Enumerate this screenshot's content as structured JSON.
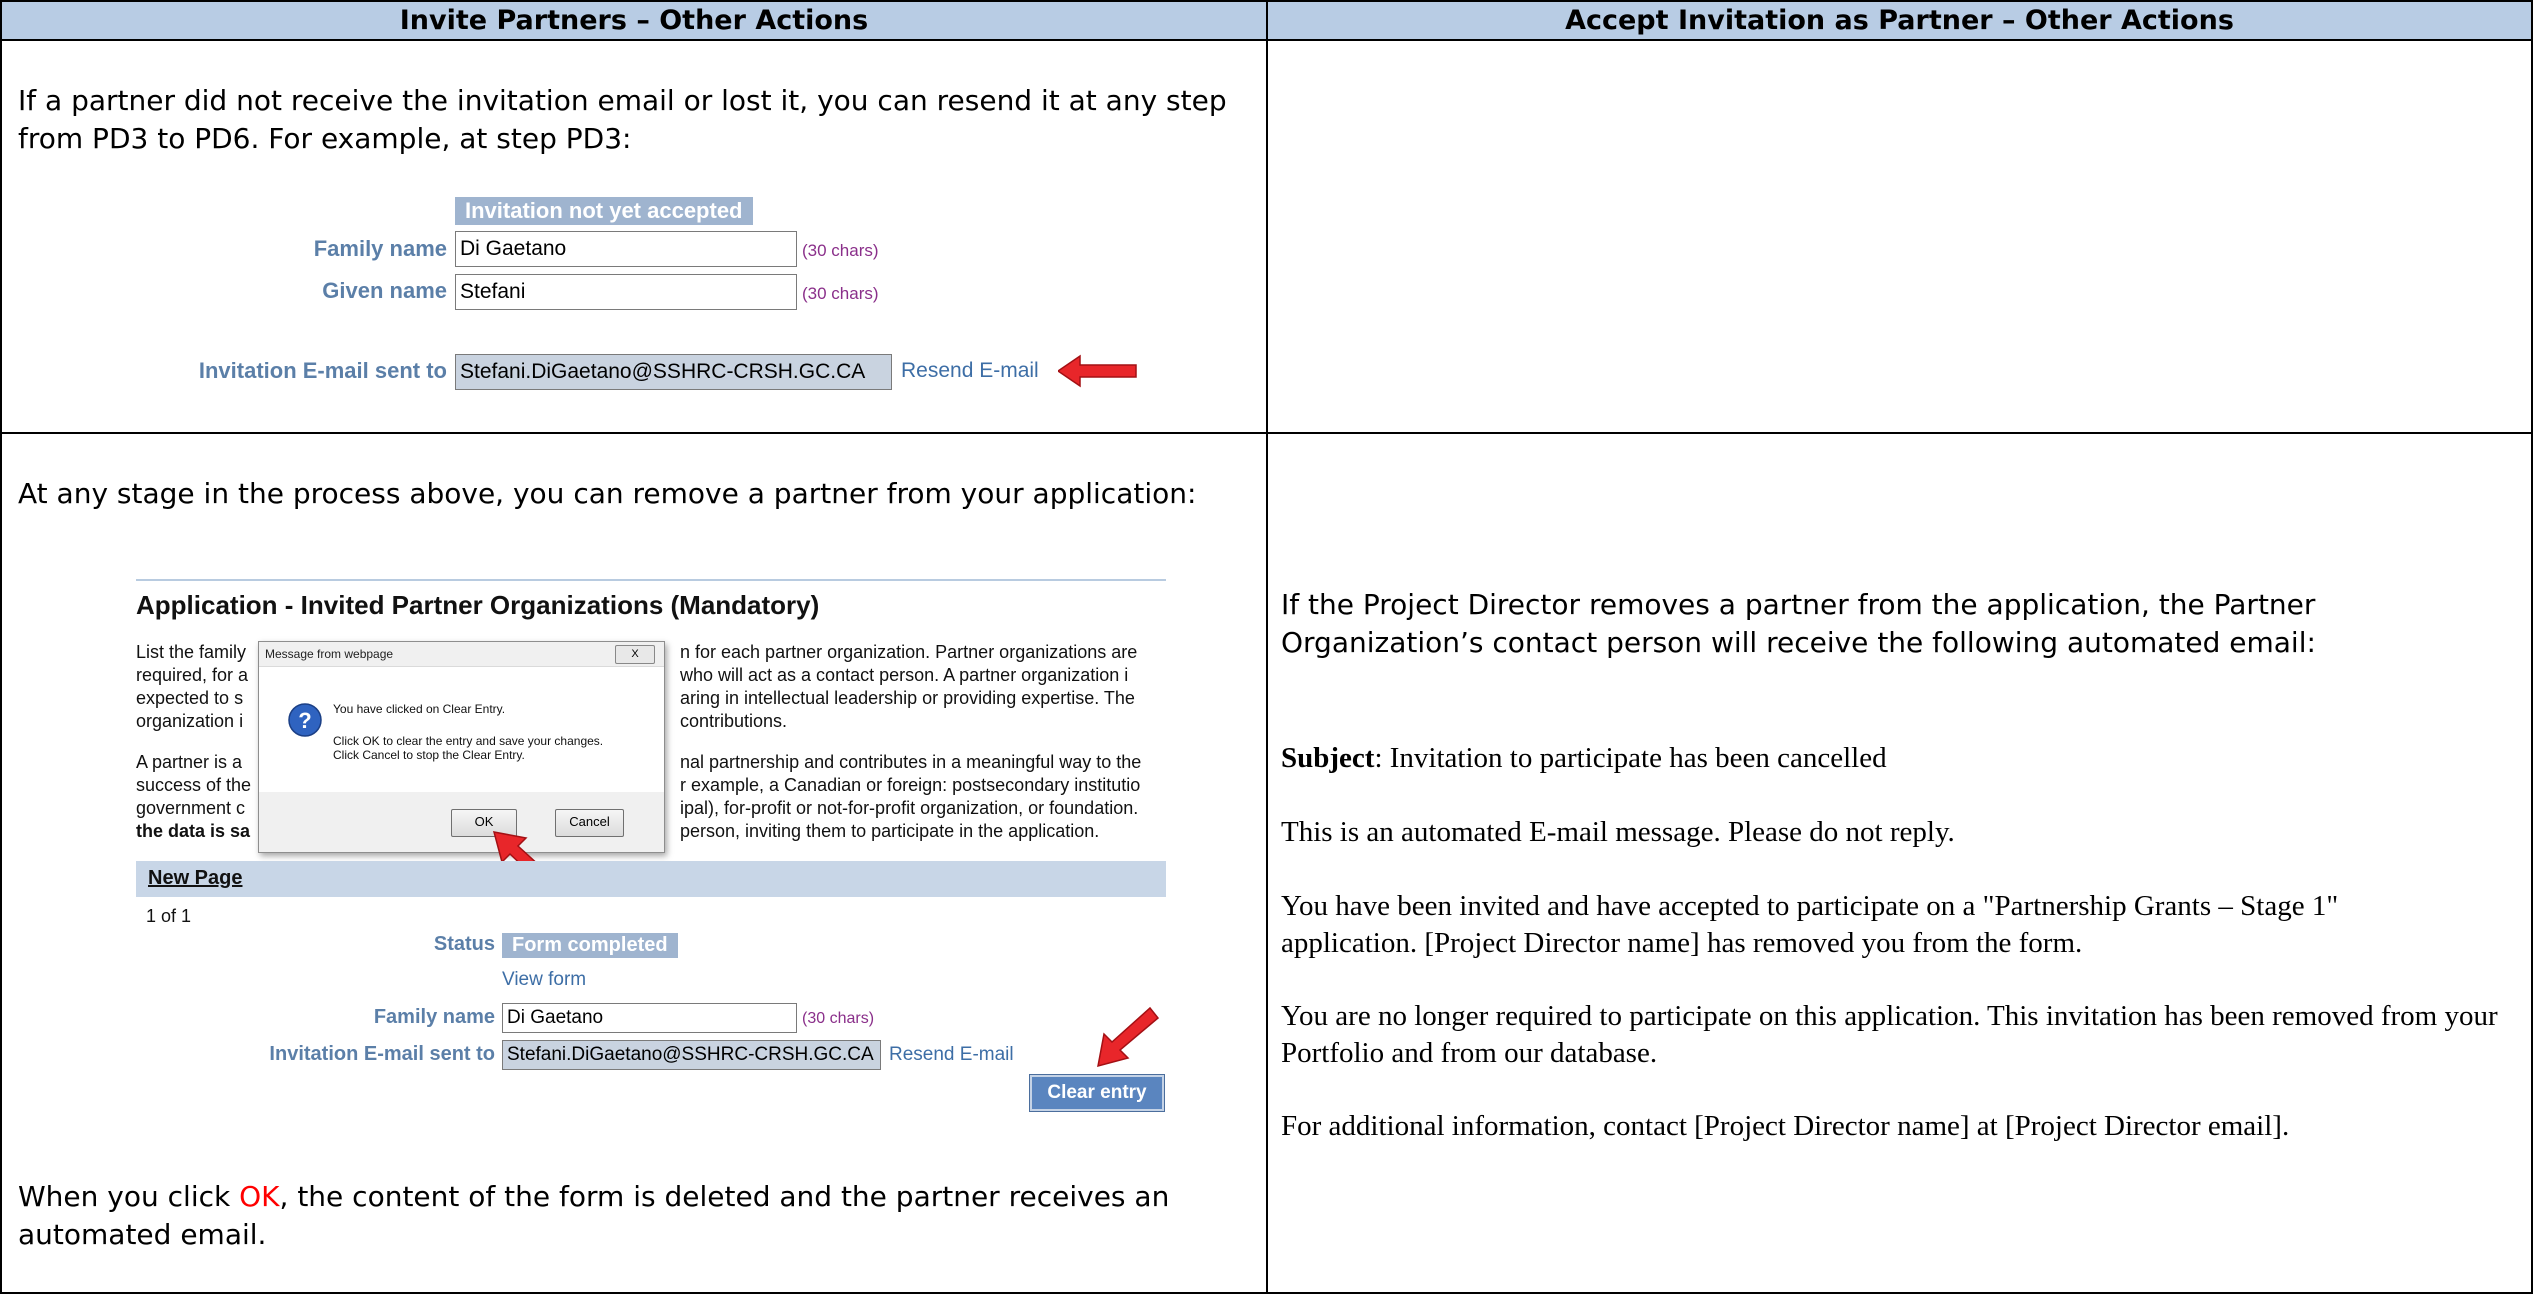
{
  "headers": {
    "left": "Invite Partners – Other Actions",
    "right": "Accept Invitation as Partner – Other Actions"
  },
  "section1": {
    "intro": "If a partner did not receive the invitation email or lost it, you can resend it at any step from PD3 to PD6. For example, at step PD3:",
    "form": {
      "status_badge": "Invitation not yet accepted",
      "family_label": "Family name",
      "family_value": "Di Gaetano",
      "family_chars": "(30 chars)",
      "given_label": "Given name",
      "given_value": "Stefani",
      "given_chars": "(30 chars)",
      "email_label": "Invitation E-mail sent to",
      "email_value": "Stefani.DiGaetano@SSHRC-CRSH.GC.CA",
      "resend_link": "Resend E-mail"
    }
  },
  "section2": {
    "intro": "At any stage in the process above, you can remove a partner from your application:",
    "screen": {
      "title": "Application - Invited Partner Organizations (Mandatory)",
      "para1_lines": [
        "List the family",
        "n for each partner organization. Partner organizations are",
        "required, for a",
        "who will act as a contact person. A partner organization i",
        "expected to s",
        "aring in intellectual leadership or providing expertise. The",
        "organization i",
        "contributions."
      ],
      "para2_lines": [
        "A partner is a",
        "nal partnership and contributes in a meaningful way to the",
        "success of the",
        "r example, a Canadian or foreign: postsecondary institutio",
        "government c",
        "ipal), for-profit or not-for-profit organization, or foundation.",
        "the data is sa",
        "person, inviting them to participate in the application."
      ],
      "new_page": "New Page",
      "page_count": "1 of 1",
      "status_label": "Status",
      "status_value": "Form completed",
      "view_form": "View form",
      "family_label": "Family name",
      "family_value": "Di Gaetano",
      "family_chars": "(30 chars)",
      "email_label": "Invitation E-mail sent to",
      "email_value": "Stefani.DiGaetano@SSHRC-CRSH.GC.CA",
      "resend_link": "Resend E-mail",
      "clear_button": "Clear entry",
      "dialog": {
        "title": "Message from webpage",
        "close": "X",
        "line1": "You have clicked on Clear Entry.",
        "line2": "Click OK to clear the entry and save your changes.",
        "line3": "Click Cancel to stop the Clear Entry.",
        "ok": "OK",
        "cancel": "Cancel"
      }
    },
    "outro_before": "When you click ",
    "outro_ok": "OK",
    "outro_after": ", the content of the form is deleted and the partner receives an automated email."
  },
  "right_section2": {
    "intro": "If the Project Director removes a partner from the application, the Partner Organization’s contact person will receive the following automated email:",
    "subject_label": "Subject",
    "subject_text": ": Invitation to participate has been cancelled",
    "p1": "This is an automated E-mail message. Please do not reply.",
    "p2": "You have been invited and have accepted to participate on a \"Partnership Grants – Stage 1\" application. [Project Director name] has removed you from the form.",
    "p3": "You are no longer required to participate on this application. This invitation has been removed from your Portfolio and from our database.",
    "p4": "For additional information, contact [Project Director name] at [Project Director email]."
  },
  "colors": {
    "header_bg": "#b8cce4",
    "label_blue": "#5b7fa8",
    "badge_bg": "#9fb4cf",
    "arrow_red": "#e8262a",
    "ok_red": "#ff0000"
  }
}
